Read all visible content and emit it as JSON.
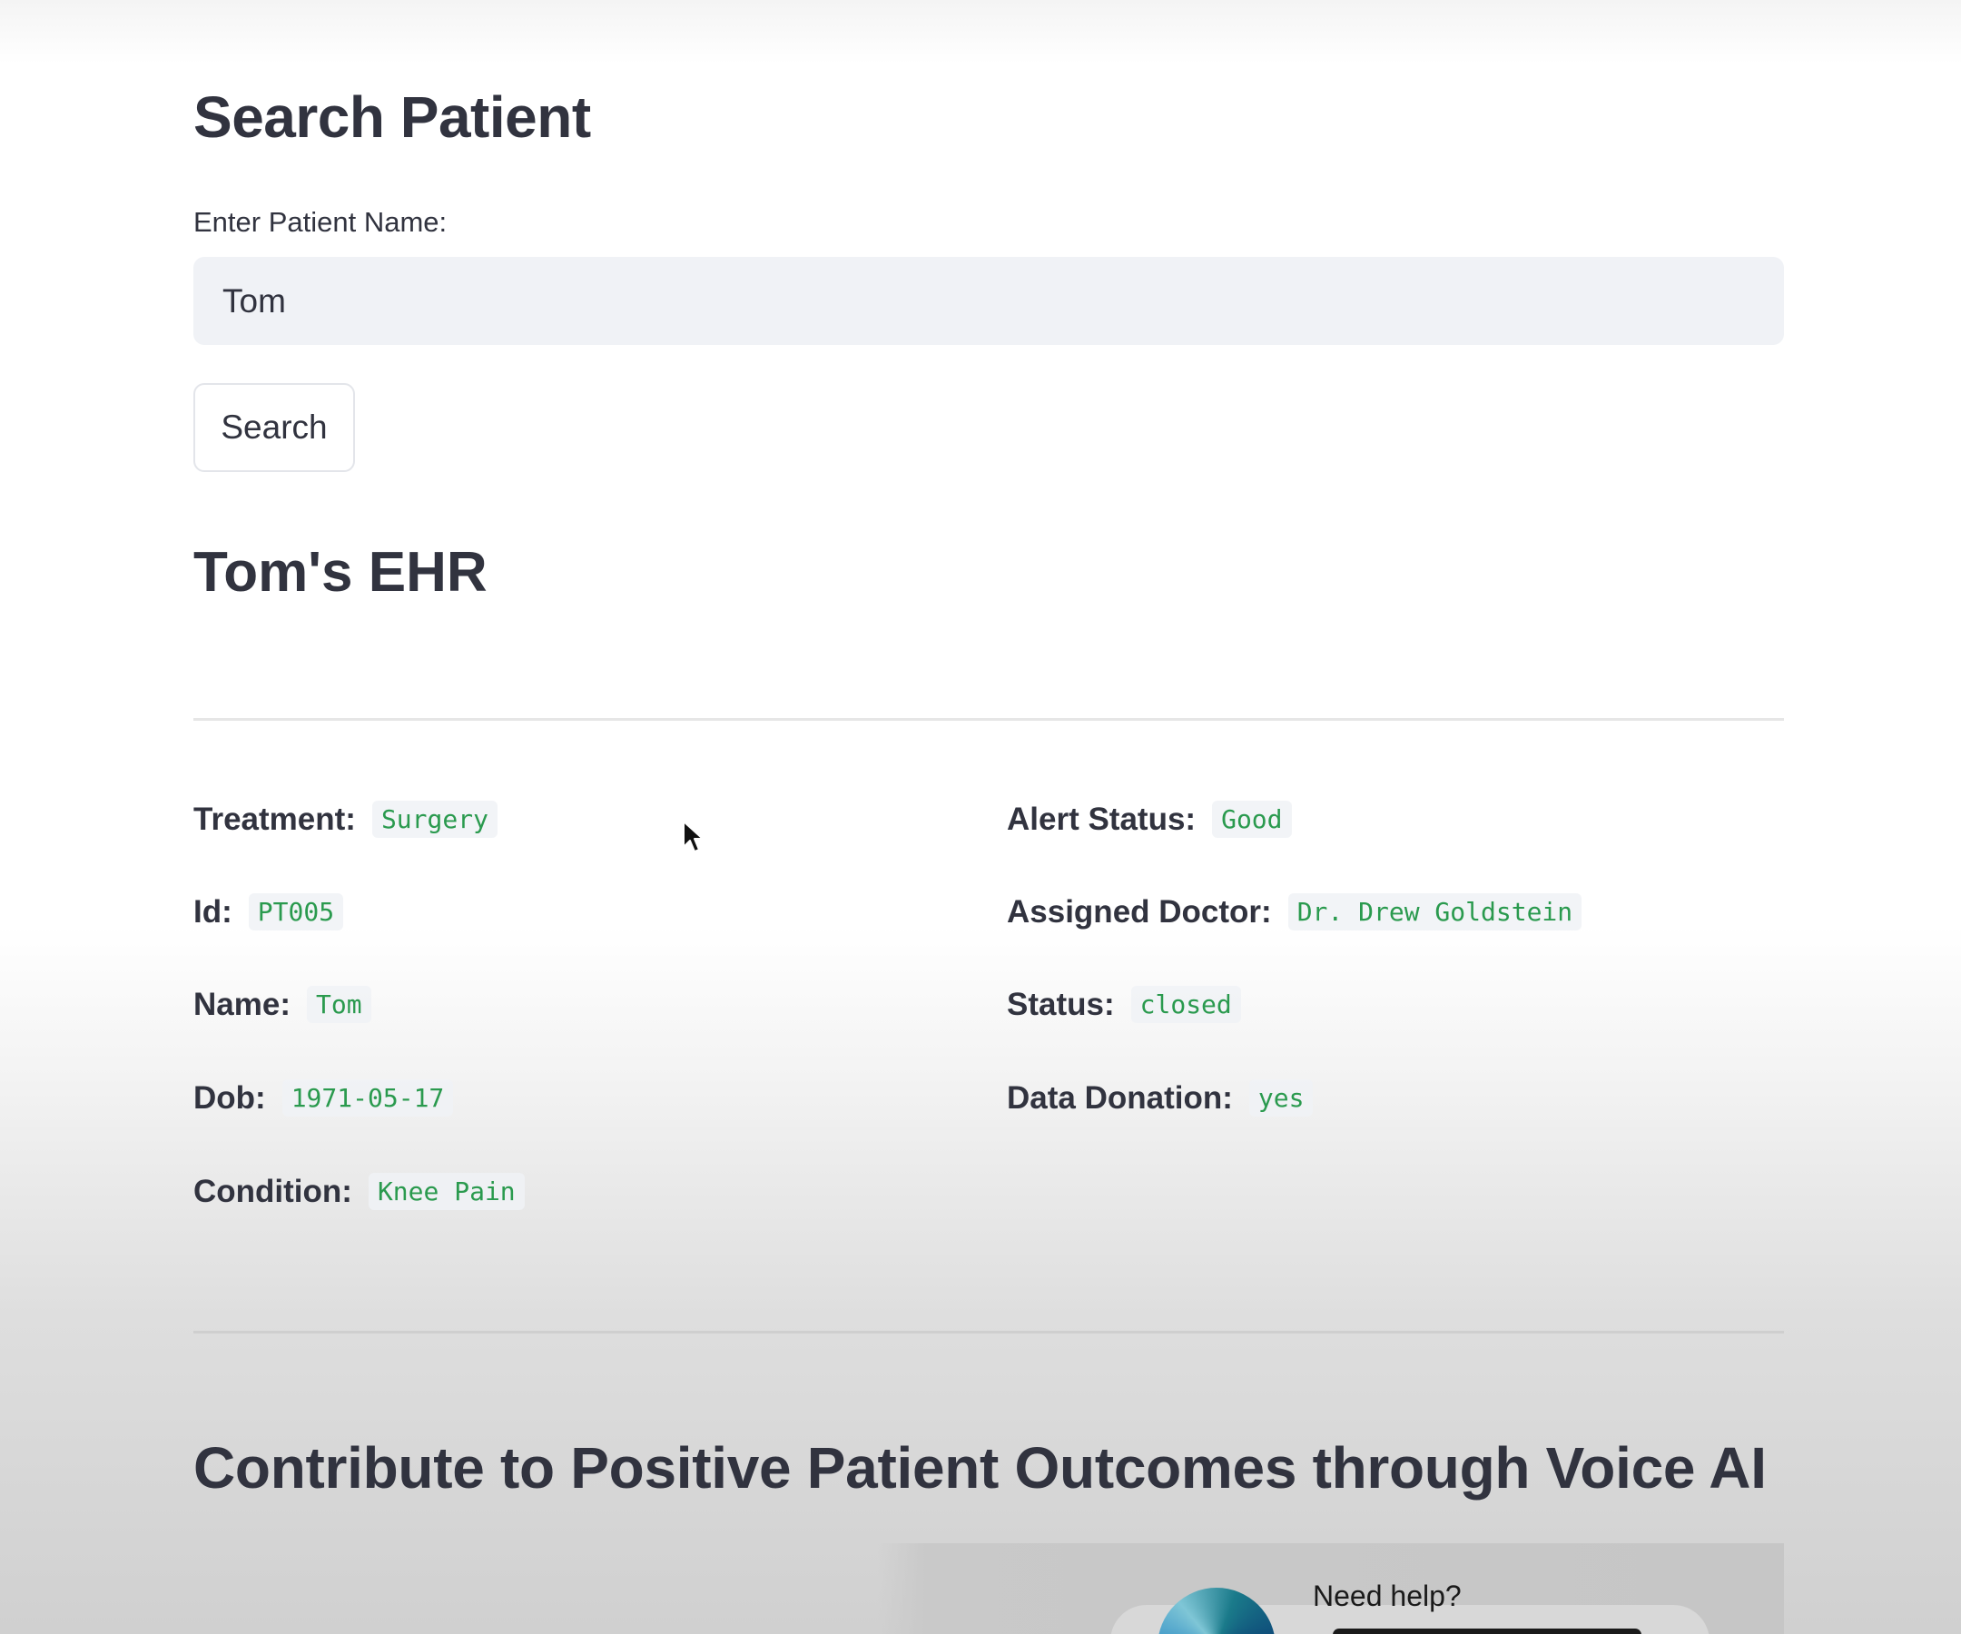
{
  "search": {
    "title": "Search Patient",
    "input_label": "Enter Patient Name:",
    "input_value": "Tom",
    "button_label": "Search"
  },
  "ehr": {
    "title": "Tom's EHR",
    "left_fields": [
      {
        "label": "Treatment:",
        "value": "Surgery"
      },
      {
        "label": "Id:",
        "value": "PT005"
      },
      {
        "label": "Name:",
        "value": "Tom"
      },
      {
        "label": "Dob:",
        "value": "1971-05-17"
      },
      {
        "label": "Condition:",
        "value": "Knee Pain"
      }
    ],
    "right_fields": [
      {
        "label": "Alert Status:",
        "value": "Good"
      },
      {
        "label": "Assigned Doctor:",
        "value": "Dr. Drew Goldstein"
      },
      {
        "label": "Status:",
        "value": "closed"
      },
      {
        "label": "Data Donation:",
        "value": "yes"
      }
    ]
  },
  "voice": {
    "title": "Contribute to Positive Patient Outcomes through Voice AI",
    "help_text": "Need help?"
  },
  "colors": {
    "value_text": "#2a9a4e",
    "heading_text": "#31333f",
    "input_bg": "#f0f2f6"
  },
  "icons": [
    "mouse-cursor-icon",
    "voice-orb-icon"
  ]
}
